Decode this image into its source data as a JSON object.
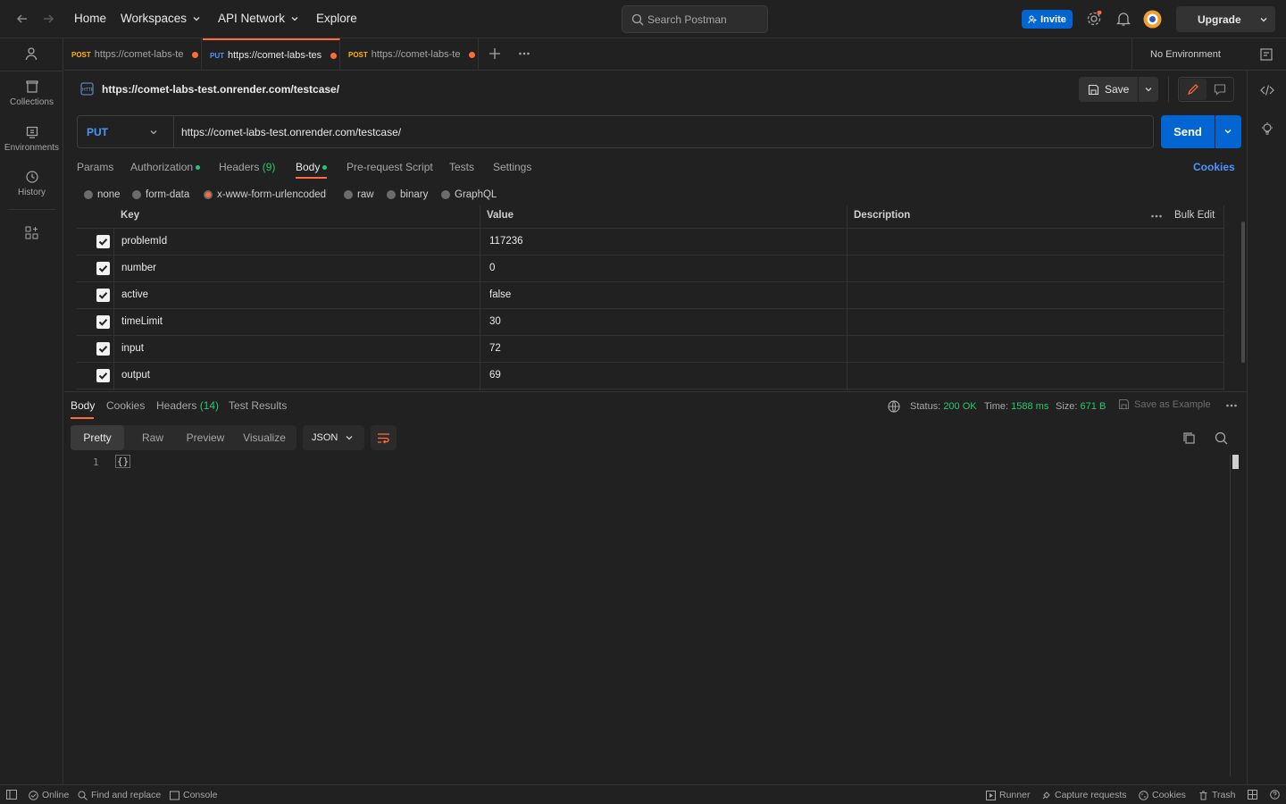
{
  "topnav": {
    "home": "Home",
    "workspaces": "Workspaces",
    "api_network": "API Network",
    "explore": "Explore",
    "search_placeholder": "Search Postman",
    "invite": "Invite",
    "upgrade": "Upgrade"
  },
  "sidebar": {
    "items": [
      {
        "label": "Collections",
        "icon": "collections-icon"
      },
      {
        "label": "Environments",
        "icon": "environments-icon"
      },
      {
        "label": "History",
        "icon": "history-icon"
      }
    ]
  },
  "tabs": [
    {
      "method": "POST",
      "title": "https://comet-labs-te",
      "method_color": "#ffb400"
    },
    {
      "method": "PUT",
      "title": "https://comet-labs-tes",
      "method_color": "#4d96ff"
    },
    {
      "method": "POST",
      "title": "https://comet-labs-te",
      "method_color": "#ffb400"
    }
  ],
  "environment": "No Environment",
  "request": {
    "title": "https://comet-labs-test.onrender.com/testcase/",
    "save": "Save",
    "method": "PUT",
    "url": "https://comet-labs-test.onrender.com/testcase/",
    "send": "Send",
    "subtabs": {
      "params": "Params",
      "authorization": "Authorization",
      "headers": "Headers",
      "headers_count": "(9)",
      "body": "Body",
      "prerequest": "Pre-request Script",
      "tests": "Tests",
      "settings": "Settings",
      "cookies": "Cookies"
    },
    "body_types": [
      "none",
      "form-data",
      "x-www-form-urlencoded",
      "raw",
      "binary",
      "GraphQL"
    ],
    "body_type_selected": "x-www-form-urlencoded",
    "table": {
      "headers": {
        "key": "Key",
        "value": "Value",
        "description": "Description",
        "bulk_edit": "Bulk Edit"
      },
      "rows": [
        {
          "key": "problemId",
          "value": "117236"
        },
        {
          "key": "number",
          "value": "0"
        },
        {
          "key": "active",
          "value": "false"
        },
        {
          "key": "timeLimit",
          "value": "30"
        },
        {
          "key": "input",
          "value": "72"
        },
        {
          "key": "output",
          "value": "69"
        }
      ]
    }
  },
  "response": {
    "tabs": {
      "body": "Body",
      "cookies": "Cookies",
      "headers": "Headers",
      "headers_count": "(14)",
      "test_results": "Test Results"
    },
    "status_label": "Status:",
    "status": "200 OK",
    "time_label": "Time:",
    "time": "1588 ms",
    "size_label": "Size:",
    "size": "671 B",
    "save_example": "Save as Example",
    "views": [
      "Pretty",
      "Raw",
      "Preview",
      "Visualize"
    ],
    "format": "JSON",
    "line_number": "1",
    "content": "{}"
  },
  "statusbar": {
    "online": "Online",
    "find_replace": "Find and replace",
    "console": "Console",
    "runner": "Runner",
    "capture": "Capture requests",
    "cookies": "Cookies",
    "trash": "Trash"
  },
  "colors": {
    "accent": "#ff6c37",
    "primary": "#0265d2",
    "success": "#28c76f"
  }
}
